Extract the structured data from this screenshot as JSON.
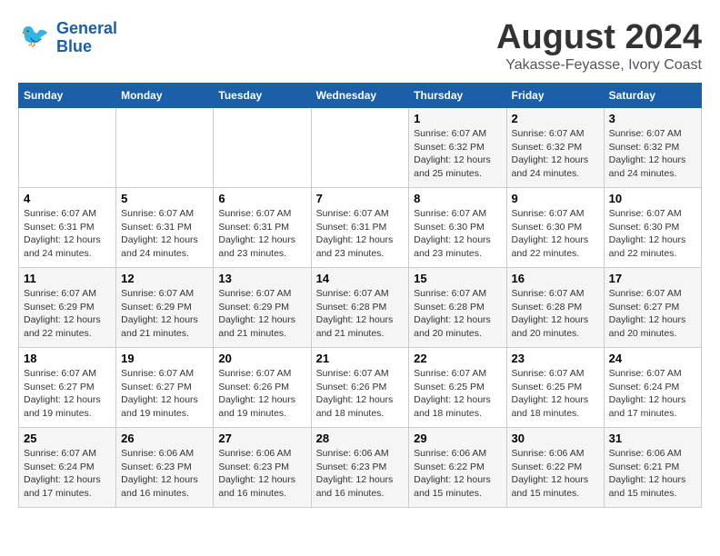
{
  "header": {
    "logo_line1": "General",
    "logo_line2": "Blue",
    "month_year": "August 2024",
    "location": "Yakasse-Feyasse, Ivory Coast"
  },
  "weekdays": [
    "Sunday",
    "Monday",
    "Tuesday",
    "Wednesday",
    "Thursday",
    "Friday",
    "Saturday"
  ],
  "weeks": [
    [
      {
        "day": "",
        "info": ""
      },
      {
        "day": "",
        "info": ""
      },
      {
        "day": "",
        "info": ""
      },
      {
        "day": "",
        "info": ""
      },
      {
        "day": "1",
        "info": "Sunrise: 6:07 AM\nSunset: 6:32 PM\nDaylight: 12 hours\nand 25 minutes."
      },
      {
        "day": "2",
        "info": "Sunrise: 6:07 AM\nSunset: 6:32 PM\nDaylight: 12 hours\nand 24 minutes."
      },
      {
        "day": "3",
        "info": "Sunrise: 6:07 AM\nSunset: 6:32 PM\nDaylight: 12 hours\nand 24 minutes."
      }
    ],
    [
      {
        "day": "4",
        "info": "Sunrise: 6:07 AM\nSunset: 6:31 PM\nDaylight: 12 hours\nand 24 minutes."
      },
      {
        "day": "5",
        "info": "Sunrise: 6:07 AM\nSunset: 6:31 PM\nDaylight: 12 hours\nand 24 minutes."
      },
      {
        "day": "6",
        "info": "Sunrise: 6:07 AM\nSunset: 6:31 PM\nDaylight: 12 hours\nand 23 minutes."
      },
      {
        "day": "7",
        "info": "Sunrise: 6:07 AM\nSunset: 6:31 PM\nDaylight: 12 hours\nand 23 minutes."
      },
      {
        "day": "8",
        "info": "Sunrise: 6:07 AM\nSunset: 6:30 PM\nDaylight: 12 hours\nand 23 minutes."
      },
      {
        "day": "9",
        "info": "Sunrise: 6:07 AM\nSunset: 6:30 PM\nDaylight: 12 hours\nand 22 minutes."
      },
      {
        "day": "10",
        "info": "Sunrise: 6:07 AM\nSunset: 6:30 PM\nDaylight: 12 hours\nand 22 minutes."
      }
    ],
    [
      {
        "day": "11",
        "info": "Sunrise: 6:07 AM\nSunset: 6:29 PM\nDaylight: 12 hours\nand 22 minutes."
      },
      {
        "day": "12",
        "info": "Sunrise: 6:07 AM\nSunset: 6:29 PM\nDaylight: 12 hours\nand 21 minutes."
      },
      {
        "day": "13",
        "info": "Sunrise: 6:07 AM\nSunset: 6:29 PM\nDaylight: 12 hours\nand 21 minutes."
      },
      {
        "day": "14",
        "info": "Sunrise: 6:07 AM\nSunset: 6:28 PM\nDaylight: 12 hours\nand 21 minutes."
      },
      {
        "day": "15",
        "info": "Sunrise: 6:07 AM\nSunset: 6:28 PM\nDaylight: 12 hours\nand 20 minutes."
      },
      {
        "day": "16",
        "info": "Sunrise: 6:07 AM\nSunset: 6:28 PM\nDaylight: 12 hours\nand 20 minutes."
      },
      {
        "day": "17",
        "info": "Sunrise: 6:07 AM\nSunset: 6:27 PM\nDaylight: 12 hours\nand 20 minutes."
      }
    ],
    [
      {
        "day": "18",
        "info": "Sunrise: 6:07 AM\nSunset: 6:27 PM\nDaylight: 12 hours\nand 19 minutes."
      },
      {
        "day": "19",
        "info": "Sunrise: 6:07 AM\nSunset: 6:27 PM\nDaylight: 12 hours\nand 19 minutes."
      },
      {
        "day": "20",
        "info": "Sunrise: 6:07 AM\nSunset: 6:26 PM\nDaylight: 12 hours\nand 19 minutes."
      },
      {
        "day": "21",
        "info": "Sunrise: 6:07 AM\nSunset: 6:26 PM\nDaylight: 12 hours\nand 18 minutes."
      },
      {
        "day": "22",
        "info": "Sunrise: 6:07 AM\nSunset: 6:25 PM\nDaylight: 12 hours\nand 18 minutes."
      },
      {
        "day": "23",
        "info": "Sunrise: 6:07 AM\nSunset: 6:25 PM\nDaylight: 12 hours\nand 18 minutes."
      },
      {
        "day": "24",
        "info": "Sunrise: 6:07 AM\nSunset: 6:24 PM\nDaylight: 12 hours\nand 17 minutes."
      }
    ],
    [
      {
        "day": "25",
        "info": "Sunrise: 6:07 AM\nSunset: 6:24 PM\nDaylight: 12 hours\nand 17 minutes."
      },
      {
        "day": "26",
        "info": "Sunrise: 6:06 AM\nSunset: 6:23 PM\nDaylight: 12 hours\nand 16 minutes."
      },
      {
        "day": "27",
        "info": "Sunrise: 6:06 AM\nSunset: 6:23 PM\nDaylight: 12 hours\nand 16 minutes."
      },
      {
        "day": "28",
        "info": "Sunrise: 6:06 AM\nSunset: 6:23 PM\nDaylight: 12 hours\nand 16 minutes."
      },
      {
        "day": "29",
        "info": "Sunrise: 6:06 AM\nSunset: 6:22 PM\nDaylight: 12 hours\nand 15 minutes."
      },
      {
        "day": "30",
        "info": "Sunrise: 6:06 AM\nSunset: 6:22 PM\nDaylight: 12 hours\nand 15 minutes."
      },
      {
        "day": "31",
        "info": "Sunrise: 6:06 AM\nSunset: 6:21 PM\nDaylight: 12 hours\nand 15 minutes."
      }
    ]
  ]
}
